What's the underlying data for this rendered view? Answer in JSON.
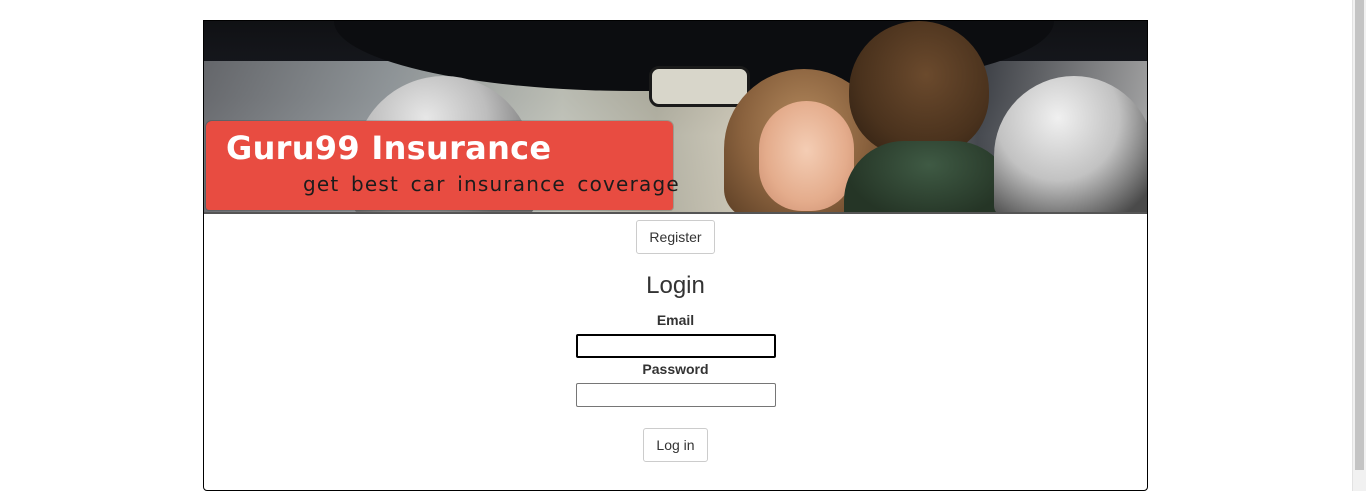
{
  "banner": {
    "brand": "Guru99 Insurance",
    "tagline": "get best car insurance coverage",
    "accent_color": "#e84c41"
  },
  "nav": {
    "register_label": "Register"
  },
  "login": {
    "title": "Login",
    "email_label": "Email",
    "email_value": "",
    "password_label": "Password",
    "password_value": "",
    "submit_label": "Log in"
  }
}
